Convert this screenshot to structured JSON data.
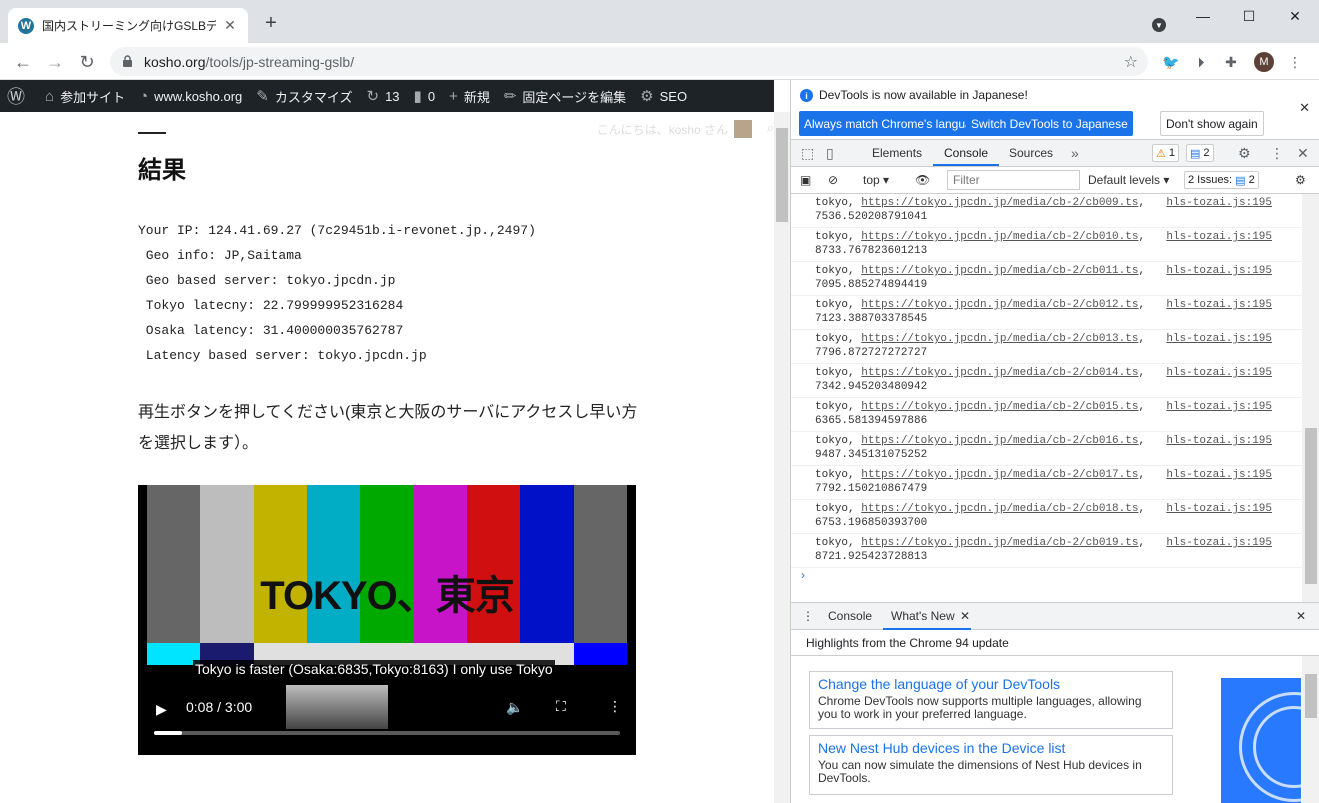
{
  "browser": {
    "tab_title": "国内ストリーミング向けGSLBデモ | ww",
    "tab_favicon": "W",
    "url_host": "kosho.org",
    "url_path": "/tools/jp-streaming-gslb/",
    "profile_initial": "M"
  },
  "wp_admin_bar": {
    "items": [
      {
        "icon": "wordpress-logo-icon",
        "label": ""
      },
      {
        "icon": "sites-icon",
        "label": "参加サイト"
      },
      {
        "icon": "dashboard-icon",
        "label": "www.kosho.org"
      },
      {
        "icon": "brush-icon",
        "label": "カスタマイズ"
      },
      {
        "icon": "update-icon",
        "label": "13"
      },
      {
        "icon": "comment-icon",
        "label": "0"
      },
      {
        "icon": "plus-icon",
        "label": "新規"
      },
      {
        "icon": "pencil-icon",
        "label": "固定ページを編集"
      },
      {
        "icon": "seo-icon",
        "label": "SEO"
      }
    ],
    "greeting": "こんにちは、kosho さん"
  },
  "content": {
    "heading": "結果",
    "result_lines": [
      "Your IP: 124.41.69.27 (7c29451b.i-revonet.jp.,2497)",
      " Geo info: JP,Saitama",
      " Geo based server: tokyo.jpcdn.jp",
      " Tokyo latecny: 22.799999952316284",
      " Osaka latency: 31.400000035762787",
      " Latency based server: tokyo.jpcdn.jp"
    ],
    "instruction": "再生ボタンを押してください(東京と大阪のサーバにアクセスし早い方を選択します）。",
    "video": {
      "overlay_title": "TOKYO、東京",
      "caption": "Tokyo is faster (Osaka:6835,Tokyo:8163) I only use Tokyo",
      "time": "0:08 / 3:00",
      "progress": 0.06,
      "colors": [
        "#666666",
        "#bdbdbd",
        "#c1b300",
        "#00adc4",
        "#00a900",
        "#c814c8",
        "#d01010",
        "#0011c8",
        "#666666"
      ],
      "lower_colors": [
        "#00e5ff",
        "#1a1a6e",
        "#e0e0e0",
        "#e0e0e0",
        "#e0e0e0",
        "#e0e0e0",
        "#e0e0e0",
        "#e0e0e0",
        "#0000ff"
      ]
    }
  },
  "devtools": {
    "info_text": "DevTools is now available in Japanese!",
    "btn_match": "Always match Chrome's language",
    "btn_switch": "Switch DevTools to Japanese",
    "btn_dont": "Don't show again",
    "tabs": [
      "Elements",
      "Console",
      "Sources"
    ],
    "warn_count": "1",
    "msg_count": "2",
    "context": "top",
    "filter_placeholder": "Filter",
    "levels": "Default levels",
    "issues": "2 Issues:",
    "issues_count": "2",
    "logs": [
      {
        "prefix": "tokyo, ",
        "url": "https://tokyo.jpcdn.jp/media/cb-2/cb009.ts",
        "value": "7536.520208791041",
        "src": "hls-tozai.js:195"
      },
      {
        "prefix": "tokyo, ",
        "url": "https://tokyo.jpcdn.jp/media/cb-2/cb010.ts",
        "value": "8733.767823601213",
        "src": "hls-tozai.js:195"
      },
      {
        "prefix": "tokyo, ",
        "url": "https://tokyo.jpcdn.jp/media/cb-2/cb011.ts",
        "value": "7095.885274894419",
        "src": "hls-tozai.js:195"
      },
      {
        "prefix": "tokyo, ",
        "url": "https://tokyo.jpcdn.jp/media/cb-2/cb012.ts",
        "value": "7123.388703378545",
        "src": "hls-tozai.js:195"
      },
      {
        "prefix": "tokyo, ",
        "url": "https://tokyo.jpcdn.jp/media/cb-2/cb013.ts",
        "value": "7796.872727272727",
        "src": "hls-tozai.js:195"
      },
      {
        "prefix": "tokyo, ",
        "url": "https://tokyo.jpcdn.jp/media/cb-2/cb014.ts",
        "value": "7342.945203480942",
        "src": "hls-tozai.js:195"
      },
      {
        "prefix": "tokyo, ",
        "url": "https://tokyo.jpcdn.jp/media/cb-2/cb015.ts",
        "value": "6365.581394597886",
        "src": "hls-tozai.js:195"
      },
      {
        "prefix": "tokyo, ",
        "url": "https://tokyo.jpcdn.jp/media/cb-2/cb016.ts",
        "value": "9487.345131075252",
        "src": "hls-tozai.js:195"
      },
      {
        "prefix": "tokyo, ",
        "url": "https://tokyo.jpcdn.jp/media/cb-2/cb017.ts",
        "value": "7792.150210867479",
        "src": "hls-tozai.js:195"
      },
      {
        "prefix": "tokyo, ",
        "url": "https://tokyo.jpcdn.jp/media/cb-2/cb018.ts",
        "value": "6753.196850393700",
        "src": "hls-tozai.js:195"
      },
      {
        "prefix": "tokyo, ",
        "url": "https://tokyo.jpcdn.jp/media/cb-2/cb019.ts",
        "value": "8721.925423728813",
        "src": "hls-tozai.js:195"
      }
    ],
    "drawer_tabs": [
      "Console",
      "What's New"
    ],
    "highlights": "Highlights from the Chrome 94 update",
    "cards": [
      {
        "title": "Change the language of your DevTools",
        "body": "Chrome DevTools now supports multiple languages, allowing you to work in your preferred language."
      },
      {
        "title": "New Nest Hub devices in the Device list",
        "body": "You can now simulate the dimensions of Nest Hub devices in DevTools."
      }
    ]
  }
}
